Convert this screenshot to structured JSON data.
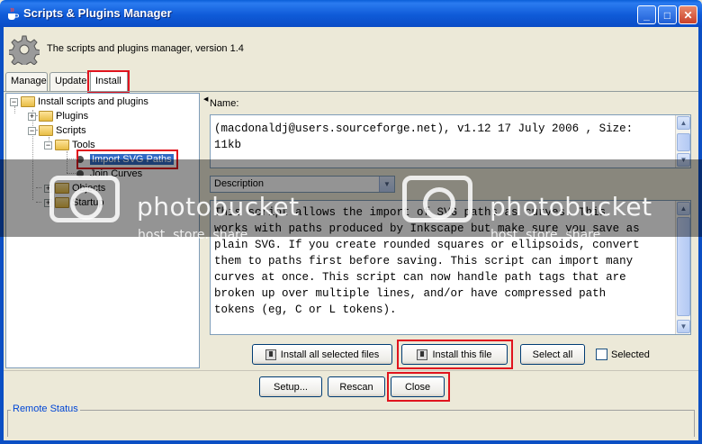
{
  "window": {
    "title": "Scripts & Plugins Manager",
    "controls": {
      "minimize": "_",
      "maximize": "□",
      "close": "✕"
    }
  },
  "header": {
    "text": "The scripts and plugins manager, version 1.4",
    "icon": "gear-icon"
  },
  "tabs": [
    {
      "label": "Manage",
      "active": false
    },
    {
      "label": "Update",
      "active": false
    },
    {
      "label": "Install",
      "active": true
    }
  ],
  "tree": {
    "root": "Install scripts and plugins",
    "plugins": "Plugins",
    "scripts": "Scripts",
    "tools": "Tools",
    "import_svg": "Import SVG Paths",
    "join_curves": "Join Curves",
    "objects": "Objects",
    "startup": "Startup",
    "selected": "Import SVG Paths"
  },
  "name_field": {
    "label": "Name:",
    "line1": "(macdonaldj@users.sourceforge.net), v1.12 17 July 2006 , Size:",
    "line2": "11kb"
  },
  "description_combo": {
    "value": "Description"
  },
  "description": {
    "lines": [
      "This script allows the import of SVG paths as curves. This",
      "works with paths produced by Inkscape but make sure you save as",
      "plain SVG. If you create rounded squares or ellipsoids, convert",
      "them to paths first before saving. This script can import many",
      "curves at once. This script can now handle path tags that are",
      "broken up over multiple lines, and/or have compressed path",
      "tokens (eg, C or L tokens)."
    ]
  },
  "buttons": {
    "install_all": "Install all selected files",
    "install_this": "Install this file",
    "select_all": "Select all",
    "selected_checkbox": "Selected",
    "setup": "Setup...",
    "rescan": "Rescan",
    "close": "Close"
  },
  "remote_status": {
    "label": "Remote Status"
  },
  "watermark": {
    "title": "photobucket",
    "subtitle": "host. store. share."
  },
  "colors": {
    "titlebar": "#0a5fd8",
    "highlight": "#e0141e",
    "selection": "#316ac5"
  }
}
